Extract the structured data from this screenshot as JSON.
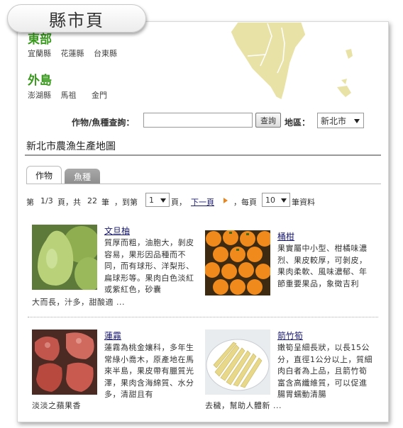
{
  "page": {
    "tab_title": "縣市頁"
  },
  "regions": [
    {
      "name": "東部",
      "counties": [
        "宜蘭縣",
        "花蓮縣",
        "台東縣"
      ]
    },
    {
      "name": "外島",
      "counties": [
        "澎湖縣",
        "馬祖",
        "金門"
      ]
    }
  ],
  "search": {
    "label": "作物/魚種查詢：",
    "placeholder": "",
    "value": "",
    "button": "查詢",
    "area_label": "地區：",
    "area_value": "新北市"
  },
  "map_title": "新北市農漁生產地圖",
  "tabs": [
    {
      "label": "作物",
      "active": true
    },
    {
      "label": "魚種",
      "active": false
    }
  ],
  "pager": {
    "prefix": "第",
    "page": "1/3",
    "page_unit": "頁，共",
    "total": "22",
    "total_unit": "筆",
    "goto": "，到第",
    "page_select": "1",
    "page_suffix": "頁，",
    "next": "下一頁",
    "per_page": "，每頁",
    "per_page_select": "10",
    "per_page_suffix": "筆資料"
  },
  "products": [
    {
      "name": "文旦柚",
      "desc_side": "質厚而粗，油胞大，剝皮容易，果形因品種而不同，而有球形、洋梨形、扁球形等。果肉白色淡紅或紫紅色，砂囊",
      "desc_bottom": "大而長，汁多，甜酸適 ...",
      "image": "pomelo"
    },
    {
      "name": "桶柑",
      "desc_side": "果實屬中小型、柑橘味濃烈、果皮較厚，可剝皮，果肉柔軟、風味濃郁、年節重要果品，象徵吉利",
      "desc_bottom": "",
      "image": "tangerine"
    },
    {
      "name": "蓮霧",
      "desc_side": "蓮霧為桃金孃科，多年生常綠小喬木，原產地在馬來半島，果皮帶有臘質光澤，果肉含海綿質、水分多，清甜且有",
      "desc_bottom": "淡淡之蘋果香",
      "image": "wax-apple"
    },
    {
      "name": "箭竹筍",
      "desc_side": "嫩筍呈細長狀，以長15公分，直徑1公分以上，質細肉白者為上品，且箭竹筍富含高纖維質，可以促進腸胃蠕動清腸",
      "desc_bottom": "去穢，幫助人體新 ...",
      "image": "bamboo-shoot"
    }
  ],
  "colors": {
    "region_title": "#3a9a1e",
    "map_land": "#e9e2a6",
    "link": "#1a1a6e",
    "tab_inactive": "#999999",
    "arrow": "#e8851f"
  }
}
